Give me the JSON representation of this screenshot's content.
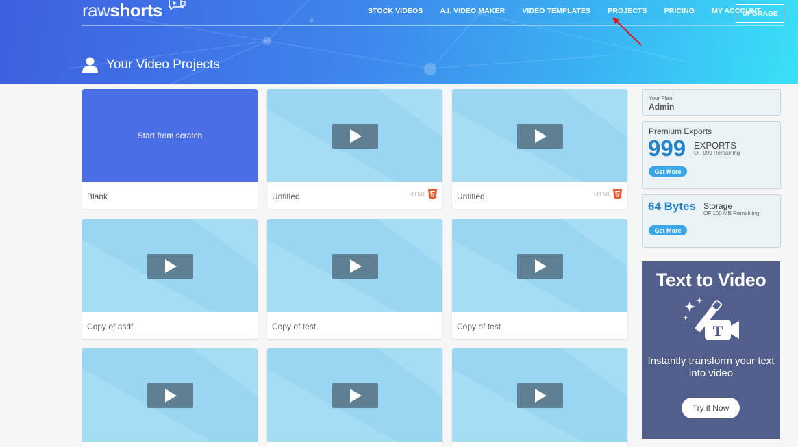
{
  "brand": {
    "logo_raw": "raw",
    "logo_shorts": "shorts"
  },
  "nav": {
    "items": [
      "STOCK VIDEOS",
      "A.I. VIDEO MAKER",
      "VIDEO TEMPLATES",
      "PROJECTS",
      "PRICING",
      "MY ACCOUNT"
    ],
    "upgrade_label": "UPGRADE"
  },
  "page": {
    "title": "Your Video Projects"
  },
  "projects": [
    {
      "label": "Blank",
      "scratch_text": "Start from scratch",
      "type": "scratch",
      "html5": false
    },
    {
      "label": "Untitled",
      "type": "video",
      "html5": true
    },
    {
      "label": "Untitled",
      "type": "video",
      "html5": true
    },
    {
      "label": "Copy of asdf",
      "type": "video",
      "html5": false
    },
    {
      "label": "Copy of test",
      "type": "video",
      "html5": false
    },
    {
      "label": "Copy of test",
      "type": "video",
      "html5": false
    },
    {
      "label": "",
      "type": "video",
      "html5": false
    },
    {
      "label": "",
      "type": "video",
      "html5": false
    },
    {
      "label": "",
      "type": "video",
      "html5": false
    }
  ],
  "html5_badge": "HTML",
  "sidebar": {
    "plan": {
      "caption": "Your Plan:",
      "value": "Admin"
    },
    "exports": {
      "heading": "Premium Exports",
      "count": "999",
      "unit": "EXPORTS",
      "remaining": "OF 999 Remaining",
      "button": "Get More"
    },
    "storage": {
      "amount": "64 Bytes",
      "unit": "Storage",
      "remaining": "OF 100 MB Remaining",
      "button": "Get More"
    },
    "promo": {
      "title": "Text to Video",
      "description": "Instantly transform your text into video",
      "button": "Try it Now"
    }
  },
  "colors": {
    "accent": "#2283c9",
    "scratch_bg": "#4a6ee5",
    "promo_bg": "#525f8c",
    "thumb_bg": "#a7dcf5",
    "annotation": "#e0141b"
  }
}
